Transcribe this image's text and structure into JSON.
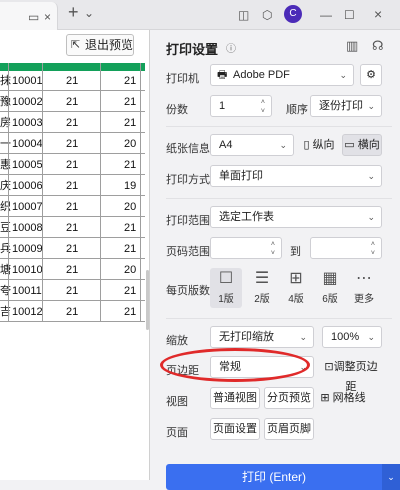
{
  "topbar": {
    "plus_label": "+",
    "chev": "⌄"
  },
  "preview": {
    "exit_label": "退出预览"
  },
  "grid": {
    "rows": [
      {
        "c0": "抹",
        "c1": "10001",
        "c2": "21",
        "c3": "21"
      },
      {
        "c0": "豫",
        "c1": "10002",
        "c2": "21",
        "c3": "21"
      },
      {
        "c0": "房",
        "c1": "10003",
        "c2": "21",
        "c3": "21"
      },
      {
        "c0": "一",
        "c1": "10004",
        "c2": "21",
        "c3": "20"
      },
      {
        "c0": "惠",
        "c1": "10005",
        "c2": "21",
        "c3": "21"
      },
      {
        "c0": "庆",
        "c1": "10006",
        "c2": "21",
        "c3": "19"
      },
      {
        "c0": "织",
        "c1": "10007",
        "c2": "21",
        "c3": "20"
      },
      {
        "c0": "豆",
        "c1": "10008",
        "c2": "21",
        "c3": "21"
      },
      {
        "c0": "兵",
        "c1": "10009",
        "c2": "21",
        "c3": "21"
      },
      {
        "c0": "塘",
        "c1": "10010",
        "c2": "21",
        "c3": "20"
      },
      {
        "c0": "夸",
        "c1": "10011",
        "c2": "21",
        "c3": "21"
      },
      {
        "c0": "吉",
        "c1": "10012",
        "c2": "21",
        "c3": "21"
      }
    ]
  },
  "panel": {
    "title": "打印设置",
    "printer_label": "打印机",
    "printer_value": "Adobe PDF",
    "copies_label": "份数",
    "copies_value": "1",
    "order_label": "顺序",
    "order_value": "逐份打印",
    "paper_label": "纸张信息",
    "paper_value": "A4",
    "portrait_label": "纵向",
    "landscape_label": "横向",
    "mode_label": "打印方式",
    "mode_value": "单面打印",
    "range_label": "打印范围",
    "range_value": "选定工作表",
    "pages_label": "页码范围",
    "pages_to": "到",
    "per_page_label": "每页版数",
    "layouts": [
      "1版",
      "2版",
      "4版",
      "6版",
      "更多"
    ],
    "scale_label": "缩放",
    "scale_value": "无打印缩放",
    "zoom_value": "100%",
    "margin_label": "页边距",
    "margin_value": "常规",
    "adjust_margin_label": "调整页边距",
    "view_label": "视图",
    "normal_view": "普通视图",
    "page_break_view": "分页预览",
    "gridlines_label": "网格线",
    "page_label": "页面",
    "page_setup": "页面设置",
    "header_footer": "页眉页脚",
    "print_button": "打印 (Enter)"
  }
}
